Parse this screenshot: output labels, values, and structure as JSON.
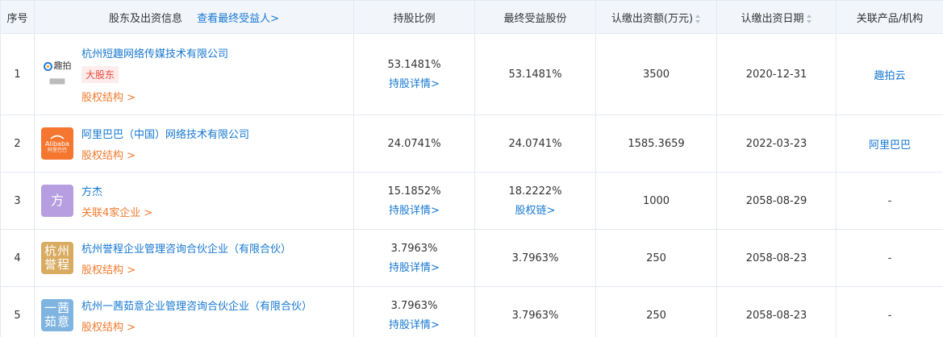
{
  "header": {
    "index": "序号",
    "holder": "股东及出资信息",
    "beneficiary_link": "查看最终受益人>",
    "ratio": "持股比例",
    "final_shares": "最终受益股份",
    "subscribed_amount": "认缴出资额(万元)",
    "subscribed_date": "认缴出资日期",
    "related": "关联产品/机构"
  },
  "rows": [
    {
      "index": "1",
      "logo_text": "趣拍",
      "logo_sub": "████",
      "name": "杭州短趣网络传媒技术有限公司",
      "badge": "大股东",
      "sub_link": "股权结构 >",
      "ratio": "53.1481%",
      "ratio_link": "持股详情>",
      "final_shares": "53.1481%",
      "final_link": "",
      "amount": "3500",
      "date": "2020-12-31",
      "related": "趣拍云"
    },
    {
      "index": "2",
      "logo_text": "Alibaba",
      "logo_sub": "阿里巴巴",
      "name": "阿里巴巴（中国）网络技术有限公司",
      "badge": "",
      "sub_link": "股权结构 >",
      "ratio": "24.0741%",
      "ratio_link": "",
      "final_shares": "24.0741%",
      "final_link": "",
      "amount": "1585.3659",
      "date": "2022-03-23",
      "related": "阿里巴巴"
    },
    {
      "index": "3",
      "logo_text": "方",
      "name": "方杰",
      "badge": "",
      "sub_link": "关联4家企业 >",
      "ratio": "15.1852%",
      "ratio_link": "持股详情>",
      "final_shares": "18.2222%",
      "final_link": "股权链>",
      "amount": "1000",
      "date": "2058-08-29",
      "related": "-"
    },
    {
      "index": "4",
      "logo_text": "杭州誉程",
      "name": "杭州誉程企业管理咨询合伙企业（有限合伙）",
      "badge": "",
      "sub_link": "股权结构 >",
      "ratio": "3.7963%",
      "ratio_link": "持股详情>",
      "final_shares": "3.7963%",
      "final_link": "",
      "amount": "250",
      "date": "2058-08-23",
      "related": "-"
    },
    {
      "index": "5",
      "logo_text": "一茜茹意",
      "name": "杭州一茜茹意企业管理咨询合伙企业（有限合伙）",
      "badge": "",
      "sub_link": "股权结构 >",
      "ratio": "3.7963%",
      "ratio_link": "持股详情>",
      "final_shares": "3.7963%",
      "final_link": "",
      "amount": "250",
      "date": "2058-08-23",
      "related": "-"
    }
  ],
  "colors": {
    "header_bg": "#f2f6fb",
    "link": "#1778d1",
    "orange": "#f07a2e",
    "badge_bg": "#fdeceb",
    "badge_text": "#e94b3c",
    "logo_alibaba": "#f5762f",
    "logo_fang": "#b79ee0",
    "logo_yucheng": "#d8ab60",
    "logo_yiqian": "#7fb4e0"
  }
}
